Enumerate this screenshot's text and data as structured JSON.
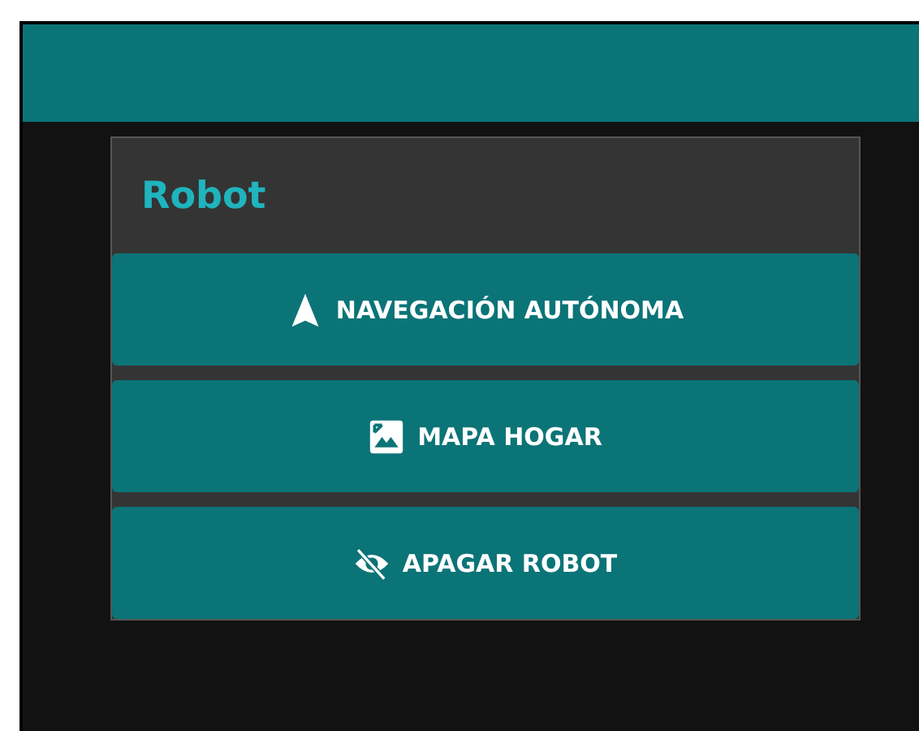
{
  "card": {
    "title": "Robot"
  },
  "buttons": [
    {
      "label": "NAVEGACIÓN AUTÓNOMA",
      "kind": "navigation"
    },
    {
      "label": "MAPA HOGAR",
      "kind": "image"
    },
    {
      "label": "APAGAR ROBOT",
      "kind": "hidden"
    }
  ]
}
